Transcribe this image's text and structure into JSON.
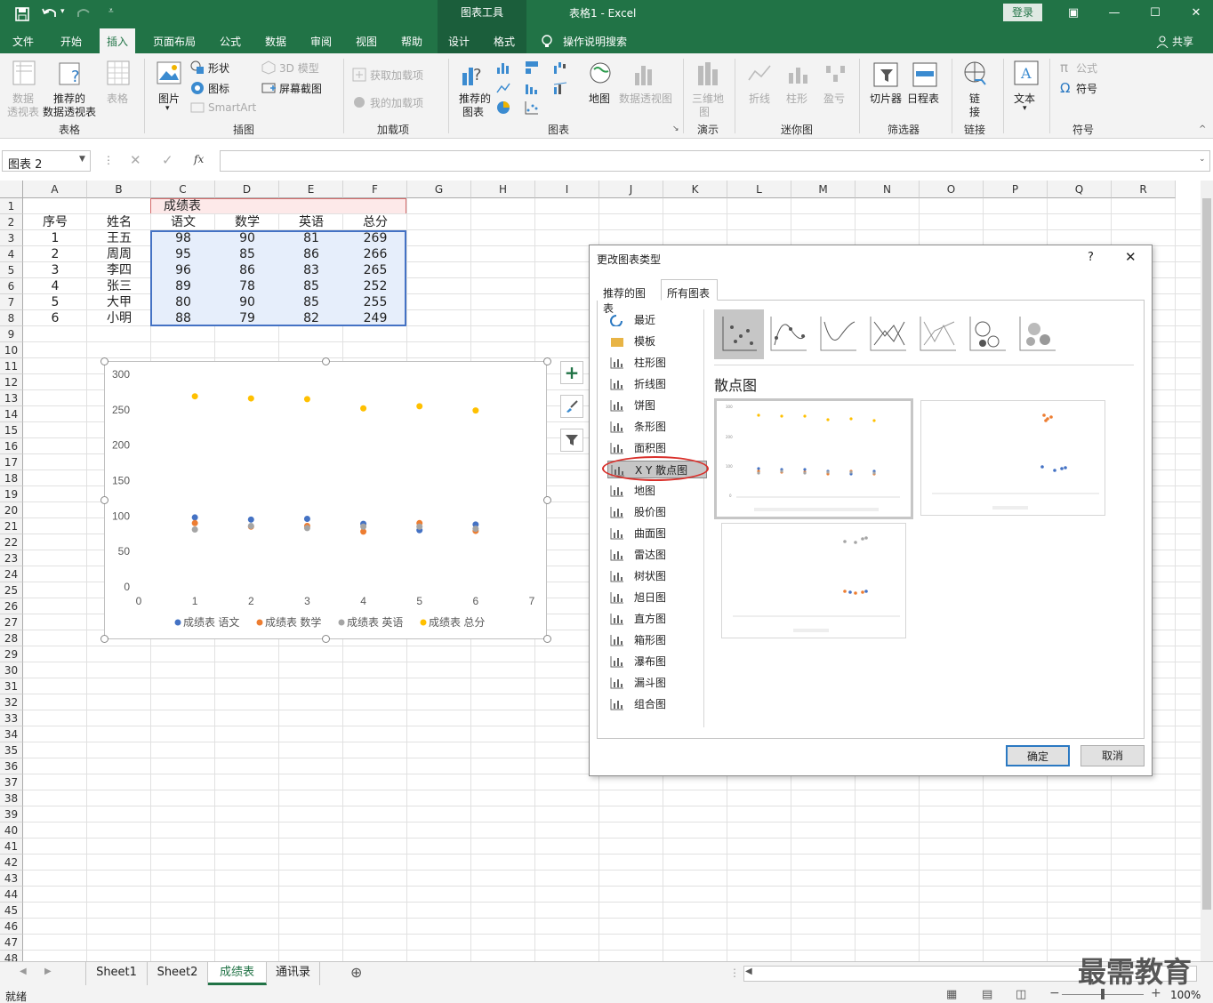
{
  "titlebar": {
    "context_group": "图表工具",
    "doc_title": "表格1  -  Excel",
    "login": "登录"
  },
  "tabs": [
    {
      "label": "文件"
    },
    {
      "label": "开始"
    },
    {
      "label": "插入"
    },
    {
      "label": "页面布局"
    },
    {
      "label": "公式"
    },
    {
      "label": "数据"
    },
    {
      "label": "审阅"
    },
    {
      "label": "视图"
    },
    {
      "label": "帮助"
    },
    {
      "label": "设计"
    },
    {
      "label": "格式"
    },
    {
      "label": "操作说明搜索"
    },
    {
      "label": "共享"
    }
  ],
  "ribbon": {
    "pivot_l1": "数据",
    "pivot_l2": "透视表",
    "rec_pivot_l1": "推荐的",
    "rec_pivot_l2": "数据透视表",
    "table": "表格",
    "group_table": "表格",
    "pictures": "图片",
    "shapes": "形状",
    "icons": "图标",
    "model3d": "3D 模型",
    "smartart": "SmartArt",
    "screenshot": "屏幕截图",
    "group_illus": "插图",
    "get_addins": "获取加载项",
    "my_addins": "我的加载项",
    "group_addins": "加载项",
    "rec_chart_l1": "推荐的",
    "rec_chart_l2": "图表",
    "maps": "地图",
    "pivot_chart": "数据透视图",
    "group_charts": "图表",
    "map3d_l1": "三维地",
    "map3d_l2": "图",
    "group_tour": "演示",
    "spark_line": "折线",
    "spark_col": "柱形",
    "spark_wl": "盈亏",
    "group_spark": "迷你图",
    "slicer": "切片器",
    "timeline": "日程表",
    "group_filter": "筛选器",
    "link_l1": "链",
    "link_l2": "接",
    "group_links": "链接",
    "text": "文本",
    "equation": "公式",
    "symbol": "符号",
    "group_symbols": "符号"
  },
  "formula_bar": {
    "name_box": "图表 2",
    "fx": "fx",
    "content": ""
  },
  "columns": [
    "A",
    "B",
    "C",
    "D",
    "E",
    "F",
    "G",
    "H",
    "I",
    "J",
    "K",
    "L",
    "M",
    "N",
    "O",
    "P",
    "Q",
    "R"
  ],
  "rows": [
    "1",
    "2",
    "3",
    "4",
    "5",
    "6",
    "7",
    "8",
    "9",
    "10",
    "11",
    "12",
    "13",
    "14",
    "15",
    "16",
    "17",
    "18",
    "19",
    "20",
    "21",
    "22",
    "23",
    "24",
    "25",
    "26",
    "27",
    "28",
    "29",
    "30",
    "31",
    "32",
    "33",
    "34",
    "35",
    "36",
    "37",
    "38",
    "39",
    "40",
    "41",
    "42",
    "43",
    "44",
    "45",
    "46",
    "47",
    "48"
  ],
  "sheet": {
    "table_title": "成绩表",
    "headers": [
      "序号",
      "姓名",
      "语文",
      "数学",
      "英语",
      "总分"
    ],
    "data": [
      [
        "1",
        "王五",
        "98",
        "90",
        "81",
        "269"
      ],
      [
        "2",
        "周周",
        "95",
        "85",
        "86",
        "266"
      ],
      [
        "3",
        "李四",
        "96",
        "86",
        "83",
        "265"
      ],
      [
        "4",
        "张三",
        "89",
        "78",
        "85",
        "252"
      ],
      [
        "5",
        "大甲",
        "80",
        "90",
        "85",
        "255"
      ],
      [
        "6",
        "小明",
        "88",
        "79",
        "82",
        "249"
      ]
    ]
  },
  "chart_data": {
    "type": "scatter",
    "x": [
      1,
      2,
      3,
      4,
      5,
      6
    ],
    "xlim": [
      0,
      7
    ],
    "ylim": [
      0,
      300
    ],
    "y_ticks": [
      "0",
      "50",
      "100",
      "150",
      "200",
      "250",
      "300"
    ],
    "x_ticks": [
      "0",
      "1",
      "2",
      "3",
      "4",
      "5",
      "6",
      "7"
    ],
    "legend_position": "bottom",
    "series": [
      {
        "name": "成绩表 语文",
        "color": "#4472c4",
        "values": [
          98,
          95,
          96,
          89,
          80,
          88
        ]
      },
      {
        "name": "成绩表 数学",
        "color": "#ed7d31",
        "values": [
          90,
          85,
          86,
          78,
          90,
          79
        ]
      },
      {
        "name": "成绩表 英语",
        "color": "#a5a5a5",
        "values": [
          81,
          86,
          83,
          85,
          85,
          82
        ]
      },
      {
        "name": "成绩表 总分",
        "color": "#ffc000",
        "values": [
          269,
          266,
          265,
          252,
          255,
          249
        ]
      }
    ]
  },
  "dialog": {
    "title": "更改图表类型",
    "help": "?",
    "close": "✕",
    "tab_recommended": "推荐的图表",
    "tab_all": "所有图表",
    "categories": [
      "最近",
      "模板",
      "柱形图",
      "折线图",
      "饼图",
      "条形图",
      "面积图",
      "X Y 散点图",
      "地图",
      "股价图",
      "曲面图",
      "雷达图",
      "树状图",
      "旭日图",
      "直方图",
      "箱形图",
      "瀑布图",
      "漏斗图",
      "组合图"
    ],
    "selected_category": "X Y 散点图",
    "subtype_heading": "散点图",
    "ok": "确定",
    "cancel": "取消"
  },
  "sheet_tabs": [
    "Sheet1",
    "Sheet2",
    "成绩表",
    "通讯录"
  ],
  "active_sheet": "成绩表",
  "status": {
    "ready": "就绪",
    "zoom": "100%",
    "watermark": "最需教育"
  }
}
